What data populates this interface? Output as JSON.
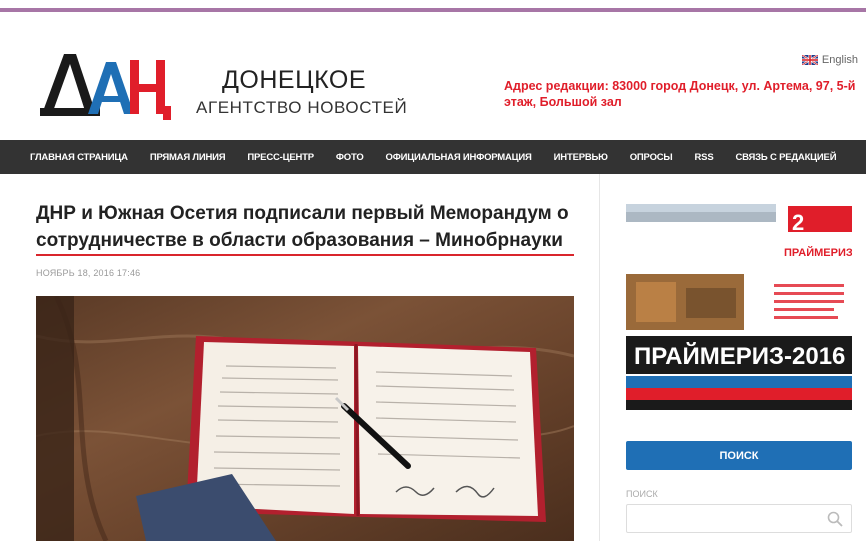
{
  "header": {
    "logo_line1": "ДОНЕЦКОЕ",
    "logo_line2": "АГЕНТСТВО НОВОСТЕЙ",
    "language_label": "English",
    "address": "Адрес редакции: 83000 город Донецк, ул. Артема, 97, 5-й этаж, Большой зал",
    "colors": {
      "brand_red": "#e01e2a",
      "brand_blue": "#1f6fb5",
      "nav_bg": "#333333"
    }
  },
  "nav": {
    "items": [
      "ГЛАВНАЯ СТРАНИЦА",
      "ПРЯМАЯ ЛИНИЯ",
      "ПРЕСС-ЦЕНТР",
      "ФОТО",
      "ОФИЦИАЛЬНАЯ ИНФОРМАЦИЯ",
      "ИНТЕРВЬЮ",
      "ОПРОСЫ",
      "RSS",
      "СВЯЗЬ С РЕДАКЦИЕЙ"
    ]
  },
  "article": {
    "title": "ДНР и Южная Осетия подписали первый Меморандум о сотрудничестве в области образования – Минобрнауки",
    "date": "НОЯБРЬ 18, 2016 17:46"
  },
  "sidebar": {
    "banner": {
      "badge_number": "2",
      "brand": "ПРАЙМЕРИЗ",
      "headline": "ПРАЙМЕРИЗ-2016"
    },
    "search_button": "ПОИСК",
    "search_label": "ПОИСК",
    "search_placeholder": ""
  }
}
